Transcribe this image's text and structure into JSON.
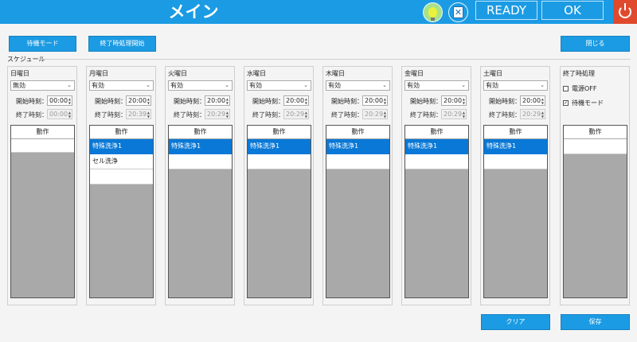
{
  "header": {
    "title": "メイン",
    "ready_label": "READY",
    "ok_label": "OK",
    "icons": [
      "lightbulb-icon",
      "clipboard-cancel-icon",
      "power-icon"
    ]
  },
  "toolbar": {
    "standby_label": "待機モード",
    "end_process_label": "終了時処理開始",
    "close_label": "閉じる"
  },
  "schedule": {
    "label": "スケジュール",
    "start_label": "開始時刻：",
    "end_label": "終了時刻：",
    "column_header": "動作",
    "days": [
      {
        "name": "日曜日",
        "state": "無効",
        "start": "00:00",
        "end": "00:00",
        "actions": []
      },
      {
        "name": "月曜日",
        "state": "有効",
        "start": "20:00",
        "end": "20:39",
        "actions": [
          "特殊洗浄1",
          "セル洗浄"
        ]
      },
      {
        "name": "火曜日",
        "state": "有効",
        "start": "20:00",
        "end": "20:29",
        "actions": [
          "特殊洗浄1"
        ]
      },
      {
        "name": "水曜日",
        "state": "有効",
        "start": "20:00",
        "end": "20:29",
        "actions": [
          "特殊洗浄1"
        ]
      },
      {
        "name": "木曜日",
        "state": "有効",
        "start": "20:00",
        "end": "20:29",
        "actions": [
          "特殊洗浄1"
        ]
      },
      {
        "name": "金曜日",
        "state": "有効",
        "start": "20:00",
        "end": "20:29",
        "actions": [
          "特殊洗浄1"
        ]
      },
      {
        "name": "土曜日",
        "state": "有効",
        "start": "20:00",
        "end": "20:29",
        "actions": [
          "特殊洗浄1"
        ]
      }
    ]
  },
  "end_process": {
    "title": "終了時処理",
    "power_off_label": "電源OFF",
    "power_off_checked": false,
    "standby_label": "待機モード",
    "standby_checked": true,
    "column_header": "動作"
  },
  "footer": {
    "clear_label": "クリア",
    "save_label": "保存"
  },
  "colors": {
    "accent": "#1b9be3",
    "selection": "#0a78d6",
    "power": "#e04a2c"
  }
}
